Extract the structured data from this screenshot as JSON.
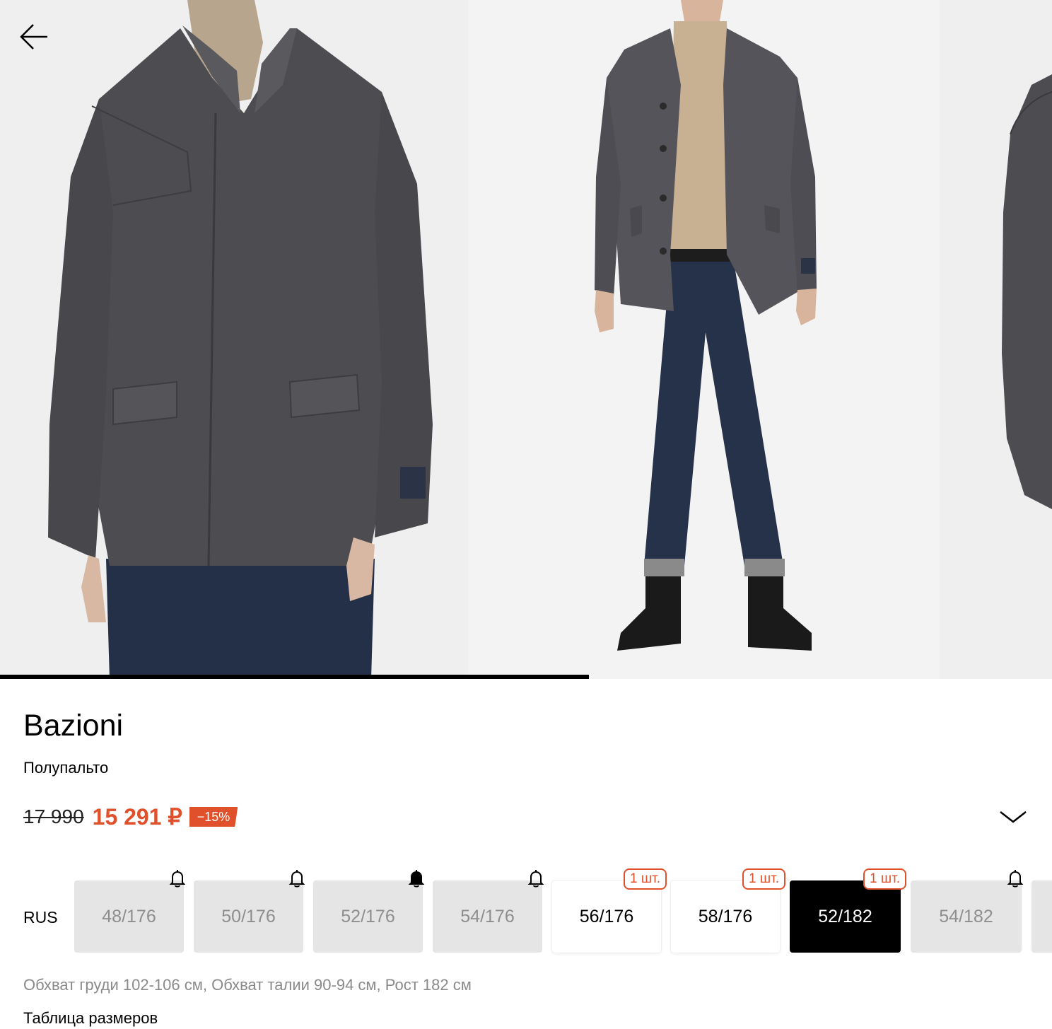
{
  "product": {
    "brand": "Bazioni",
    "name": "Полупальто",
    "old_price": "17 990",
    "new_price": "15 291 ₽",
    "discount": "−15%"
  },
  "gallery": {
    "photos": [
      "photo-1",
      "photo-2",
      "photo-3"
    ],
    "progress_fraction": 0.56
  },
  "sizes": {
    "system": "RUS",
    "items": [
      {
        "label": "48/176",
        "state": "unavailable",
        "icon": "bell-icon"
      },
      {
        "label": "50/176",
        "state": "unavailable",
        "icon": "bell-icon"
      },
      {
        "label": "52/176",
        "state": "unavailable",
        "icon": "bell-filled-icon"
      },
      {
        "label": "54/176",
        "state": "unavailable",
        "icon": "bell-icon"
      },
      {
        "label": "56/176",
        "state": "available",
        "badge": "1 шт."
      },
      {
        "label": "58/176",
        "state": "available",
        "badge": "1 шт."
      },
      {
        "label": "52/182",
        "state": "selected",
        "badge": "1 шт."
      },
      {
        "label": "54/182",
        "state": "unavailable",
        "icon": "bell-icon"
      }
    ],
    "description": "Обхват груди 102-106 см, Обхват талии 90-94 см, Рост 182 см",
    "table_link": "Таблица размеров"
  },
  "colors": {
    "accent": "#e0502a",
    "selected_bg": "#000000",
    "unavailable_bg": "#e5e5e5"
  }
}
